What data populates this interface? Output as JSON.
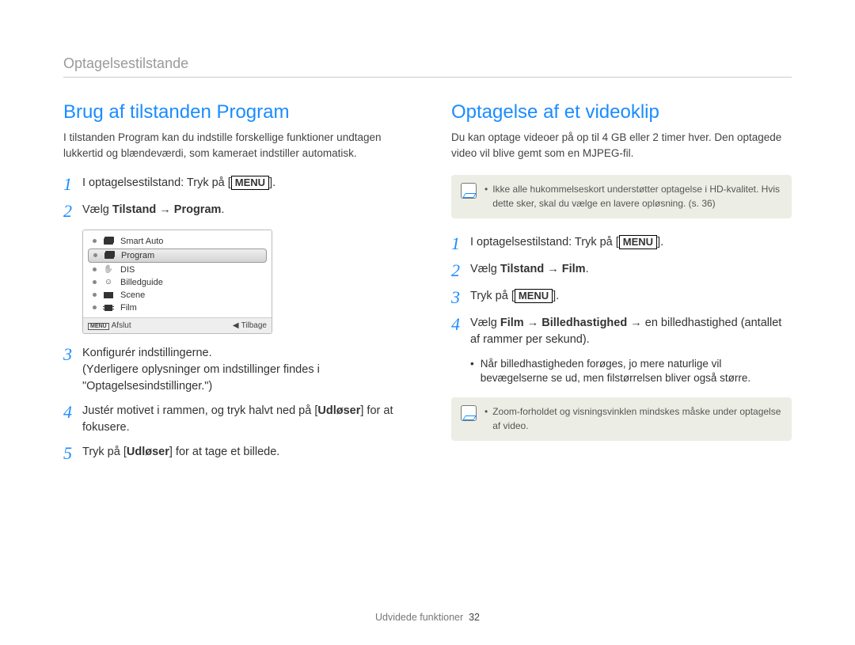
{
  "breadcrumb": "Optagelsestilstande",
  "left": {
    "title": "Brug af tilstanden Program",
    "intro": "I tilstanden Program kan du indstille forskellige funktioner undtagen lukkertid og blændeværdi, som kameraet indstiller automatisk.",
    "steps": {
      "s1_pre": "I optagelsestilstand: Tryk på [",
      "s1_btn": "MENU",
      "s1_post": "].",
      "s2_pre": "Vælg ",
      "s2_bold": "Tilstand → Program",
      "s2_post": ".",
      "s3": "Konfigurér indstillingerne.",
      "s3b": "(Yderligere oplysninger om indstillinger findes i \"Optagelsesindstillinger.\")",
      "s4_pre": "Justér motivet i rammen, og tryk halvt ned på [",
      "s4_bold": "Udløser",
      "s4_post": "] for at fokusere.",
      "s5_pre": "Tryk på [",
      "s5_bold": "Udløser",
      "s5_post": "] for at tage et billede."
    },
    "lcd": {
      "items": [
        "Smart Auto",
        "Program",
        "DIS",
        "Billedguide",
        "Scene",
        "Film"
      ],
      "selected_index": 1,
      "footer_left_btn": "MENU",
      "footer_left": "Afslut",
      "footer_right_glyph": "◀",
      "footer_right": "Tilbage"
    }
  },
  "right": {
    "title": "Optagelse af et videoklip",
    "intro": "Du kan optage videoer på op til 4 GB eller 2 timer hver. Den optagede video vil blive gemt som en MJPEG-fil.",
    "note1": "Ikke alle hukommelseskort understøtter optagelse i HD-kvalitet. Hvis dette sker, skal du vælge en lavere opløsning. (s. 36)",
    "steps": {
      "s1_pre": "I optagelsestilstand: Tryk på [",
      "s1_btn": "MENU",
      "s1_post": "].",
      "s2_pre": "Vælg ",
      "s2_bold": "Tilstand → Film",
      "s2_post": ".",
      "s3_pre": "Tryk på [",
      "s3_btn": "MENU",
      "s3_post": "].",
      "s4_pre": "Vælg ",
      "s4_bold": "Film → Billedhastighed →",
      "s4_post": " en billedhastighed (antallet af rammer per sekund).",
      "s4_sub": "Når billedhastigheden forøges, jo mere naturlige vil bevægelserne se ud, men filstørrelsen bliver også større."
    },
    "note2": "Zoom-forholdet og visningsvinklen mindskes måske under optagelse af video."
  },
  "footer": {
    "section": "Udvidede funktioner",
    "page": "32"
  },
  "step_numbers": {
    "n1": "1",
    "n2": "2",
    "n3": "3",
    "n4": "4",
    "n5": "5"
  }
}
